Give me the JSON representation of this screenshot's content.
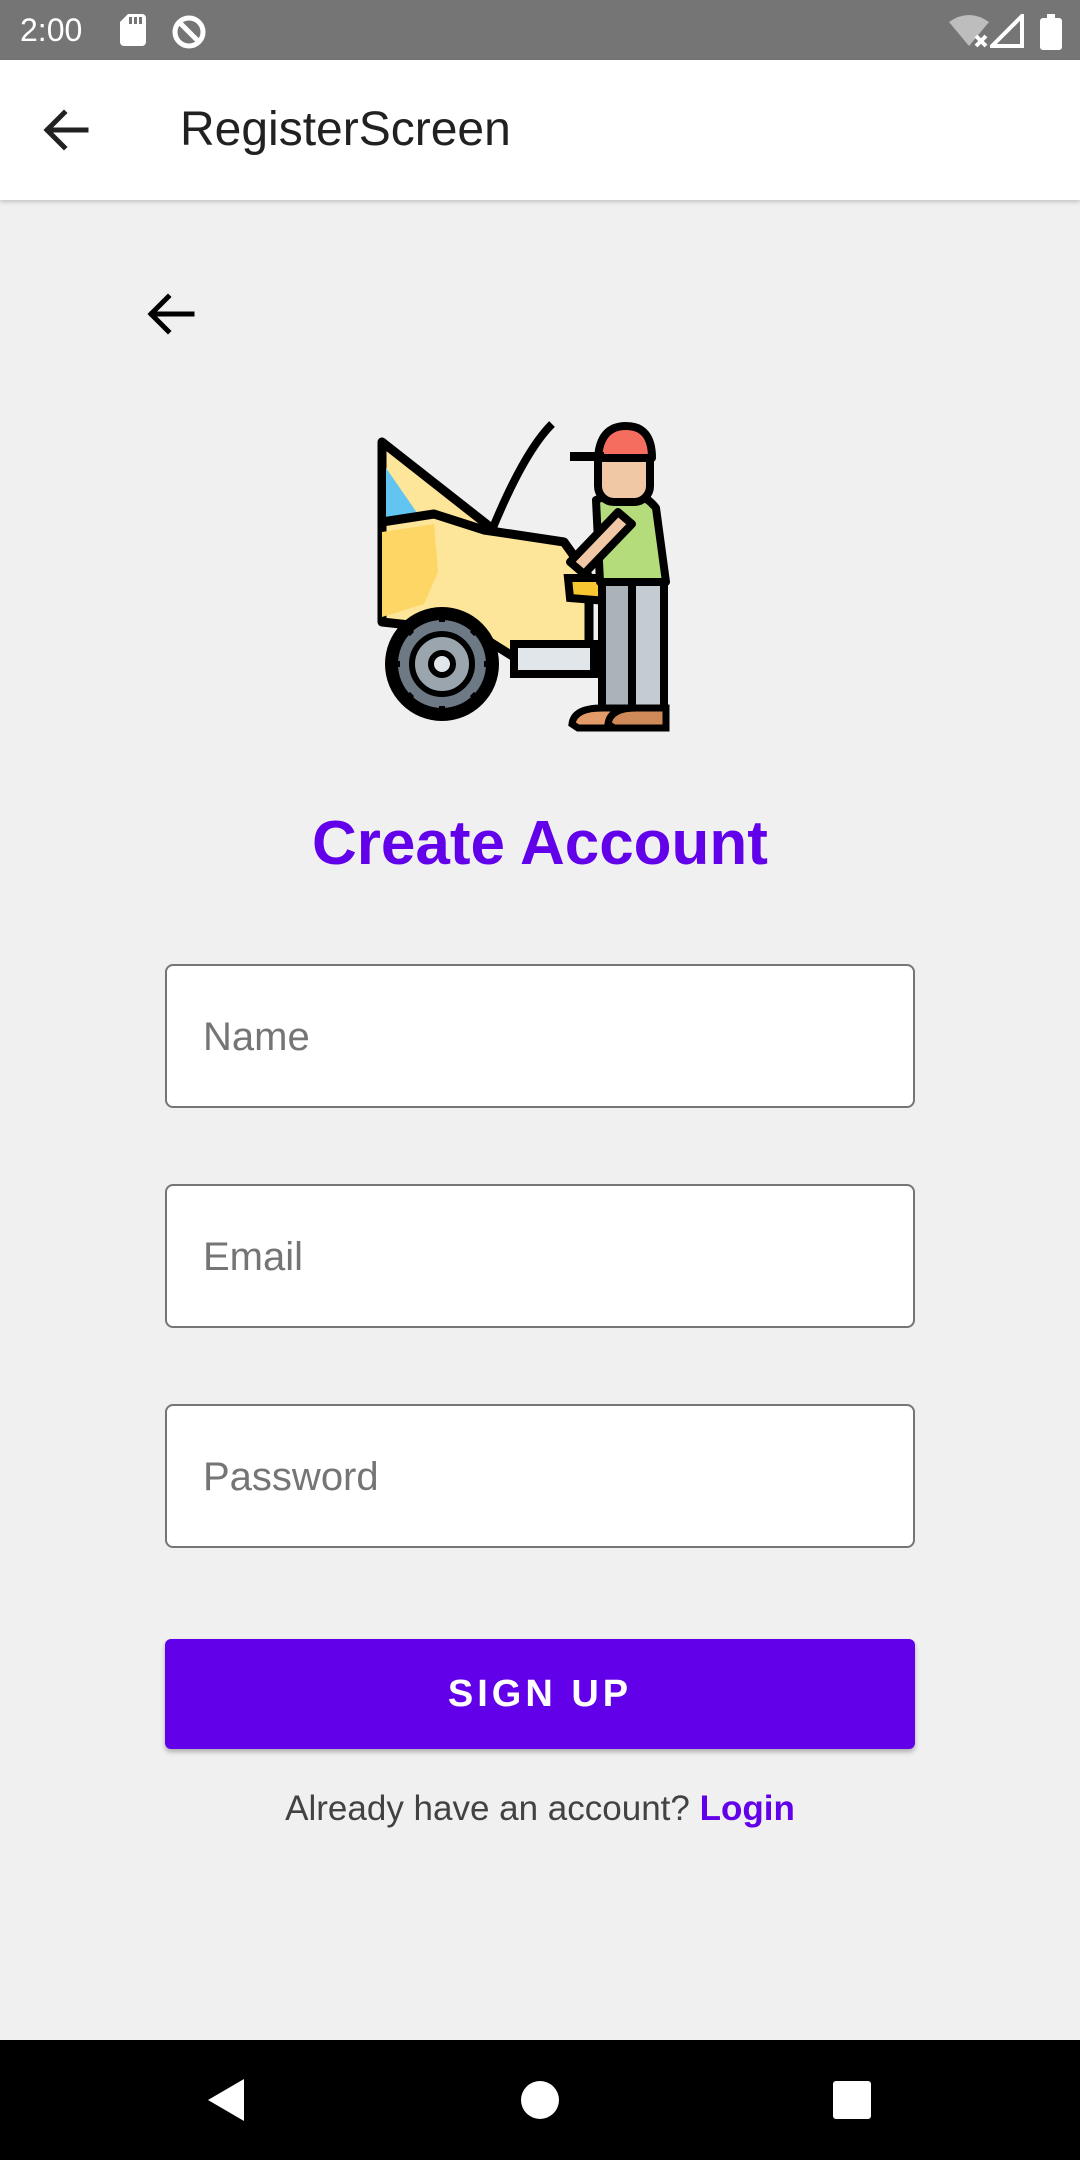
{
  "status_bar": {
    "time": "2:00",
    "icons": [
      "sd-card-icon",
      "data-saver-icon",
      "wifi-off-icon",
      "signal-icon",
      "battery-icon"
    ]
  },
  "app_bar": {
    "title": "RegisterScreen",
    "back_icon": "arrow-back-icon"
  },
  "content": {
    "back_icon": "arrow-back-icon",
    "illustration": "car-mechanic-illustration",
    "heading": "Create Account"
  },
  "form": {
    "name_placeholder": "Name",
    "email_placeholder": "Email",
    "password_placeholder": "Password",
    "submit_label": "SIGN UP"
  },
  "footer": {
    "prompt": "Already have an account? ",
    "login_label": "Login"
  },
  "nav_bar": {
    "icons": [
      "back-triangle-icon",
      "home-circle-icon",
      "recents-square-icon"
    ]
  },
  "colors": {
    "accent": "#6200ea",
    "background": "#f0f0f0",
    "status_bar": "#757575"
  }
}
